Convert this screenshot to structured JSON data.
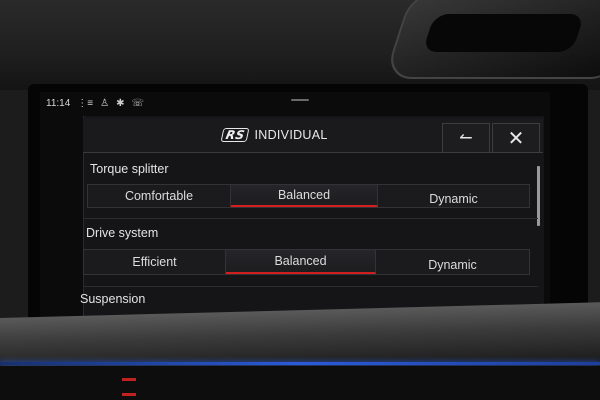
{
  "status_bar": {
    "time": "11:14",
    "icons": [
      "signal-icon",
      "person-icon",
      "bluetooth-icon",
      "phone-icon"
    ]
  },
  "header": {
    "logo_text": "RS",
    "title": "INDIVIDUAL",
    "back_icon": "back-arrow-icon",
    "close_icon": "close-icon"
  },
  "sections": [
    {
      "label": "Torque splitter",
      "options": [
        "Comfortable",
        "Balanced",
        "Dynamic"
      ],
      "selected": "Balanced"
    },
    {
      "label": "Drive system",
      "options": [
        "Efficient",
        "Balanced",
        "Dynamic"
      ],
      "selected": "Balanced"
    },
    {
      "label": "Suspension"
    }
  ],
  "colors": {
    "selection_accent": "#d21e1e",
    "ambient_strip": "#2a5bd8"
  }
}
